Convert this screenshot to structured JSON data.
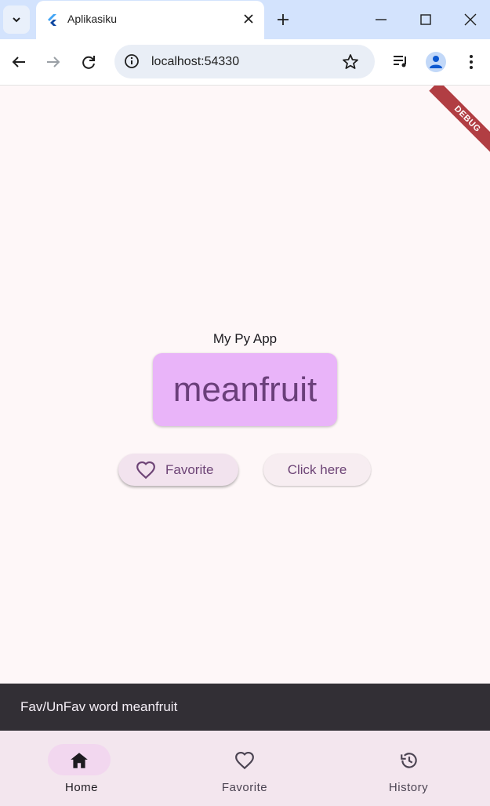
{
  "browser": {
    "tab_title": "Aplikasiku",
    "url": "localhost:54330"
  },
  "app": {
    "debug_banner": "DEBUG",
    "title": "My Py App",
    "current_word": "meanfruit",
    "favorite_button_label": "Favorite",
    "click_button_label": "Click here",
    "snackbar_message": "Fav/UnFav word meanfruit"
  },
  "nav": {
    "items": [
      {
        "label": "Home",
        "icon": "home-icon",
        "selected": true
      },
      {
        "label": "Favorite",
        "icon": "heart-outline-icon",
        "selected": false
      },
      {
        "label": "History",
        "icon": "history-icon",
        "selected": false
      }
    ]
  },
  "colors": {
    "accent": "#6a3f7a",
    "card": "#e9b4f9",
    "page_background": "#fef7f8",
    "snackbar": "#322f35",
    "nav_indicator": "#f2d7ef"
  }
}
